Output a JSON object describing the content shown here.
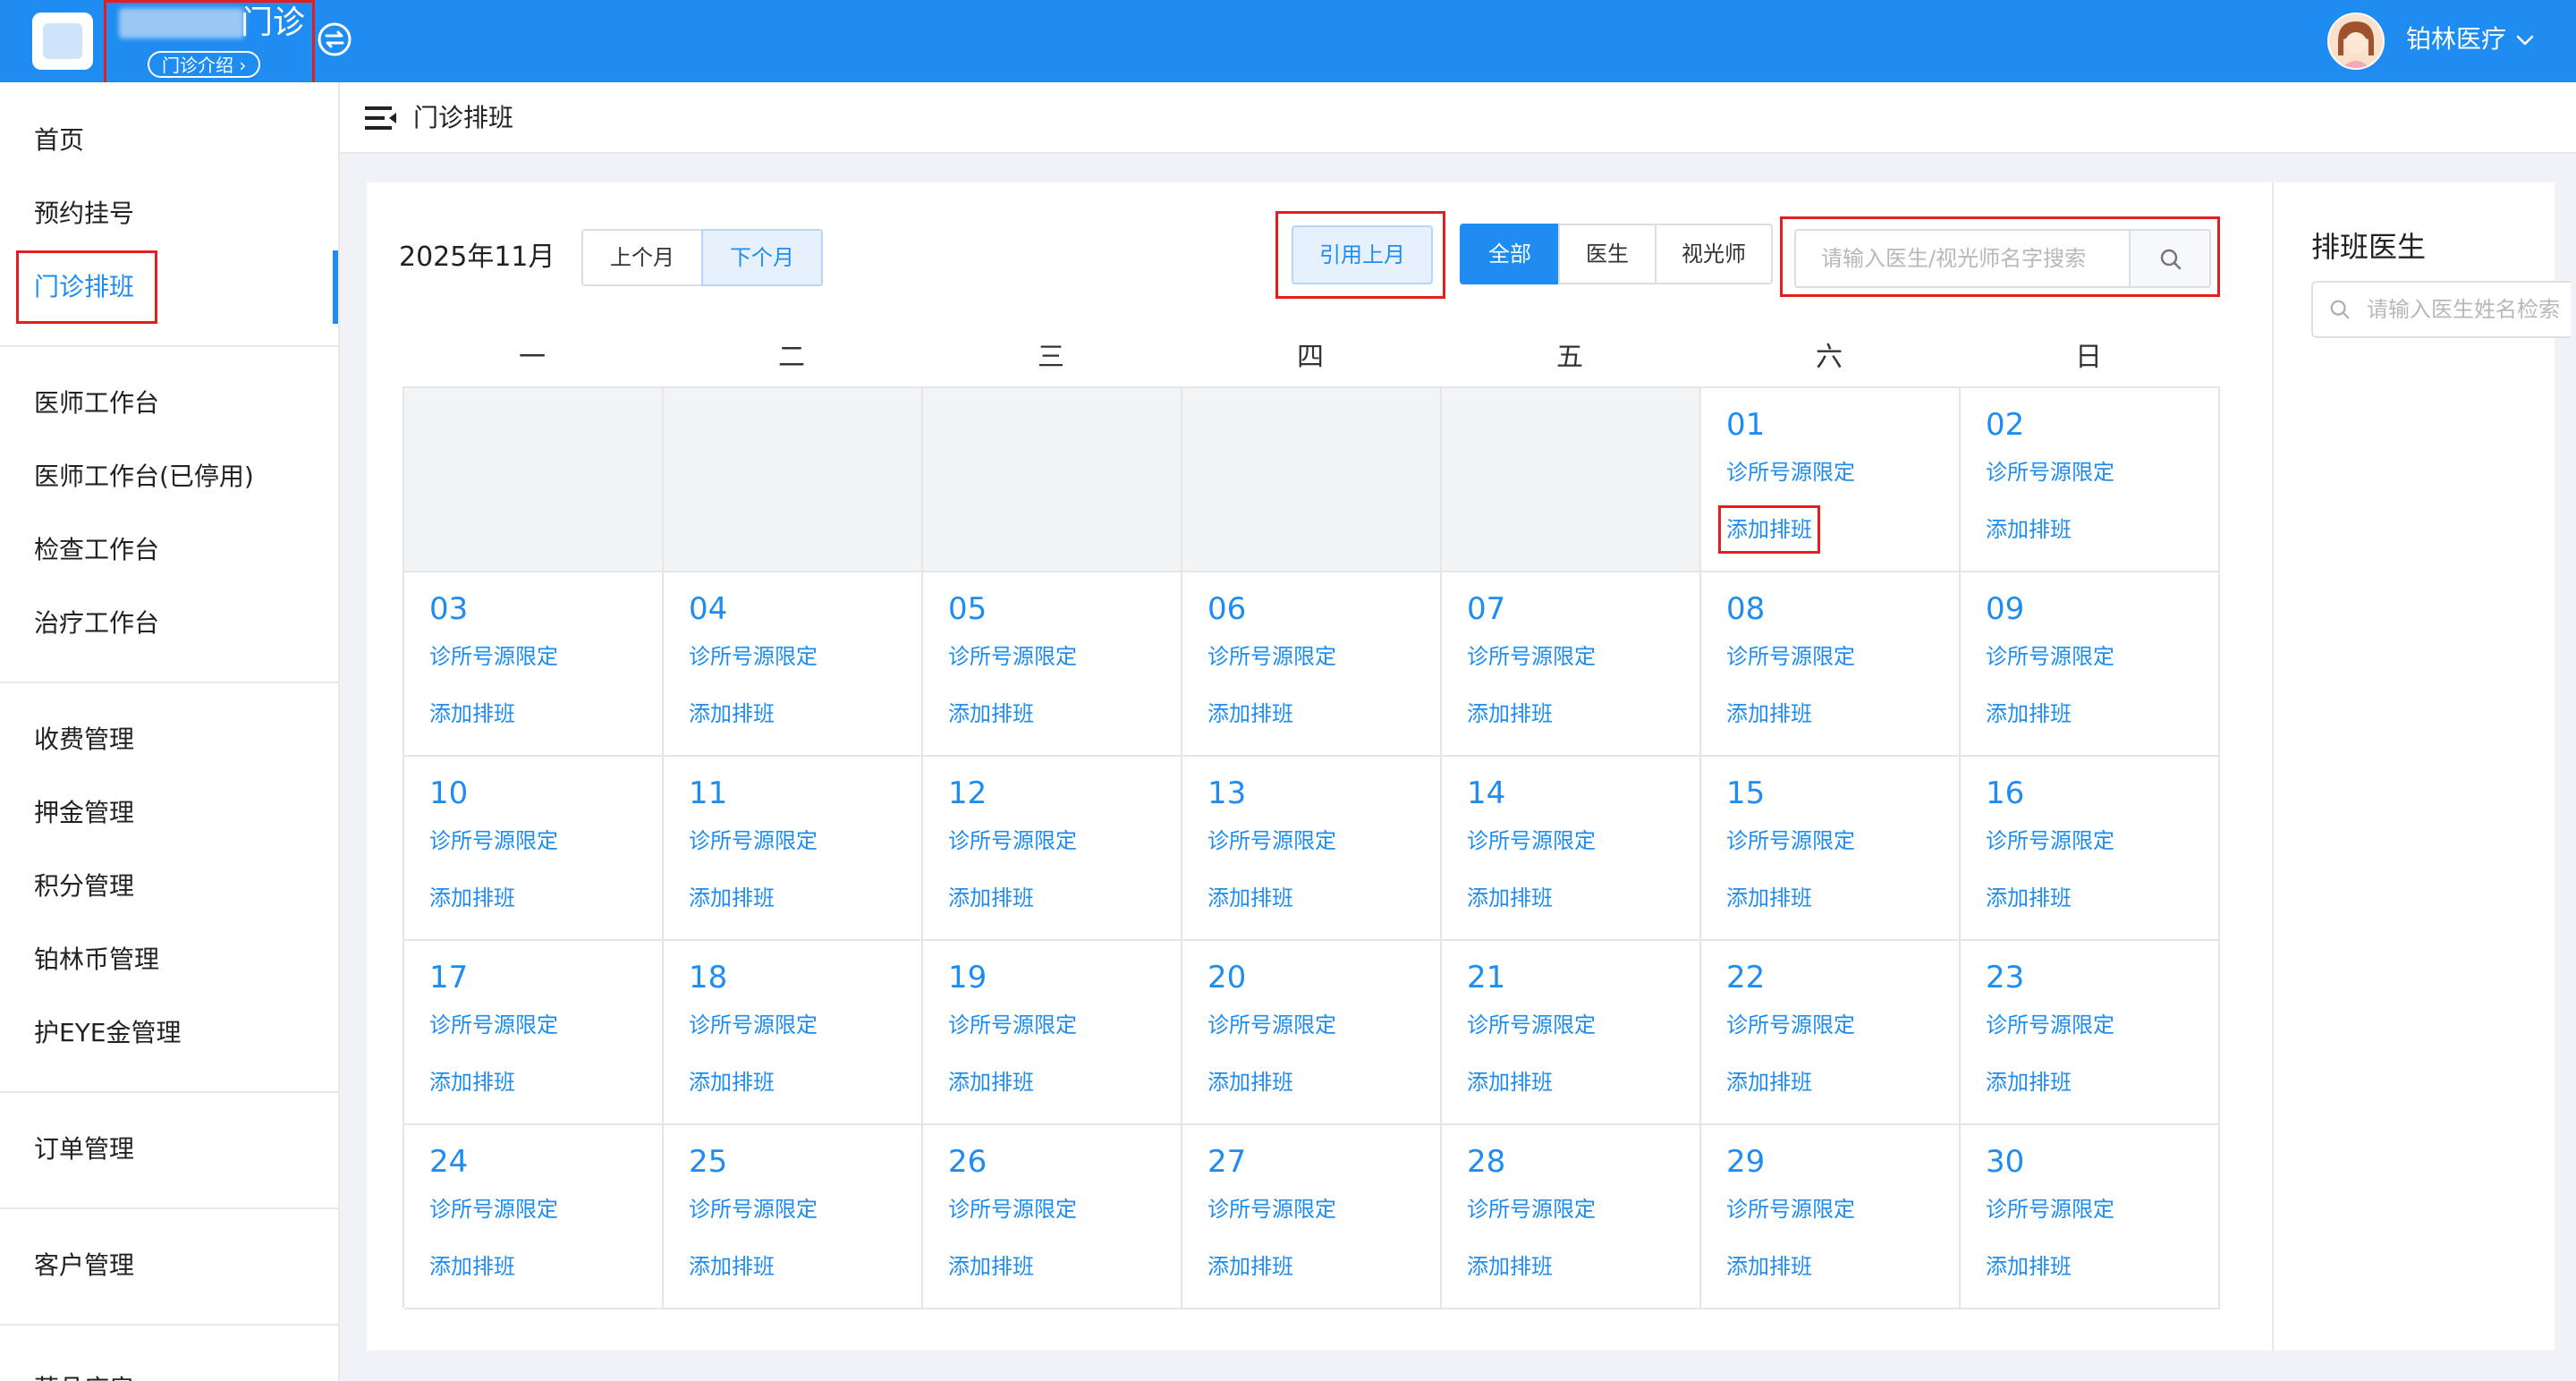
{
  "header": {
    "clinic_name_suffix": "门诊",
    "clinic_intro": "门诊介绍 ›",
    "user_name": "铂林医疗",
    "brand_color": "#1e8cf0"
  },
  "sidebar": {
    "items": [
      {
        "label": "首页"
      },
      {
        "label": "预约挂号"
      },
      {
        "label": "门诊排班",
        "active": true
      },
      {
        "label": "医师工作台"
      },
      {
        "label": "医师工作台(已停用)"
      },
      {
        "label": "检查工作台"
      },
      {
        "label": "治疗工作台"
      },
      {
        "label": "收费管理"
      },
      {
        "label": "押金管理"
      },
      {
        "label": "积分管理"
      },
      {
        "label": "铂林币管理"
      },
      {
        "label": "护EYE金管理"
      },
      {
        "label": "订单管理"
      },
      {
        "label": "客户管理"
      },
      {
        "label": "药品库房"
      }
    ]
  },
  "page": {
    "title": "门诊排班"
  },
  "toolbar": {
    "month": "2025年11月",
    "prev_month": "上个月",
    "next_month": "下个月",
    "copy_last_month": "引用上月",
    "filters": [
      "全部",
      "医生",
      "视光师"
    ],
    "search_placeholder": "请输入医生/视光师名字搜索"
  },
  "calendar": {
    "weekdays": [
      "一",
      "二",
      "三",
      "四",
      "五",
      "六",
      "日"
    ],
    "leading_blanks": 5,
    "days": [
      "01",
      "02",
      "03",
      "04",
      "05",
      "06",
      "07",
      "08",
      "09",
      "10",
      "11",
      "12",
      "13",
      "14",
      "15",
      "16",
      "17",
      "18",
      "19",
      "20",
      "21",
      "22",
      "23",
      "24",
      "25",
      "26",
      "27",
      "28",
      "29",
      "30"
    ],
    "limit_label": "诊所号源限定",
    "add_label": "添加排班"
  },
  "doctor_panel": {
    "title": "排班医生",
    "search_placeholder": "请输入医生姓名检索"
  }
}
